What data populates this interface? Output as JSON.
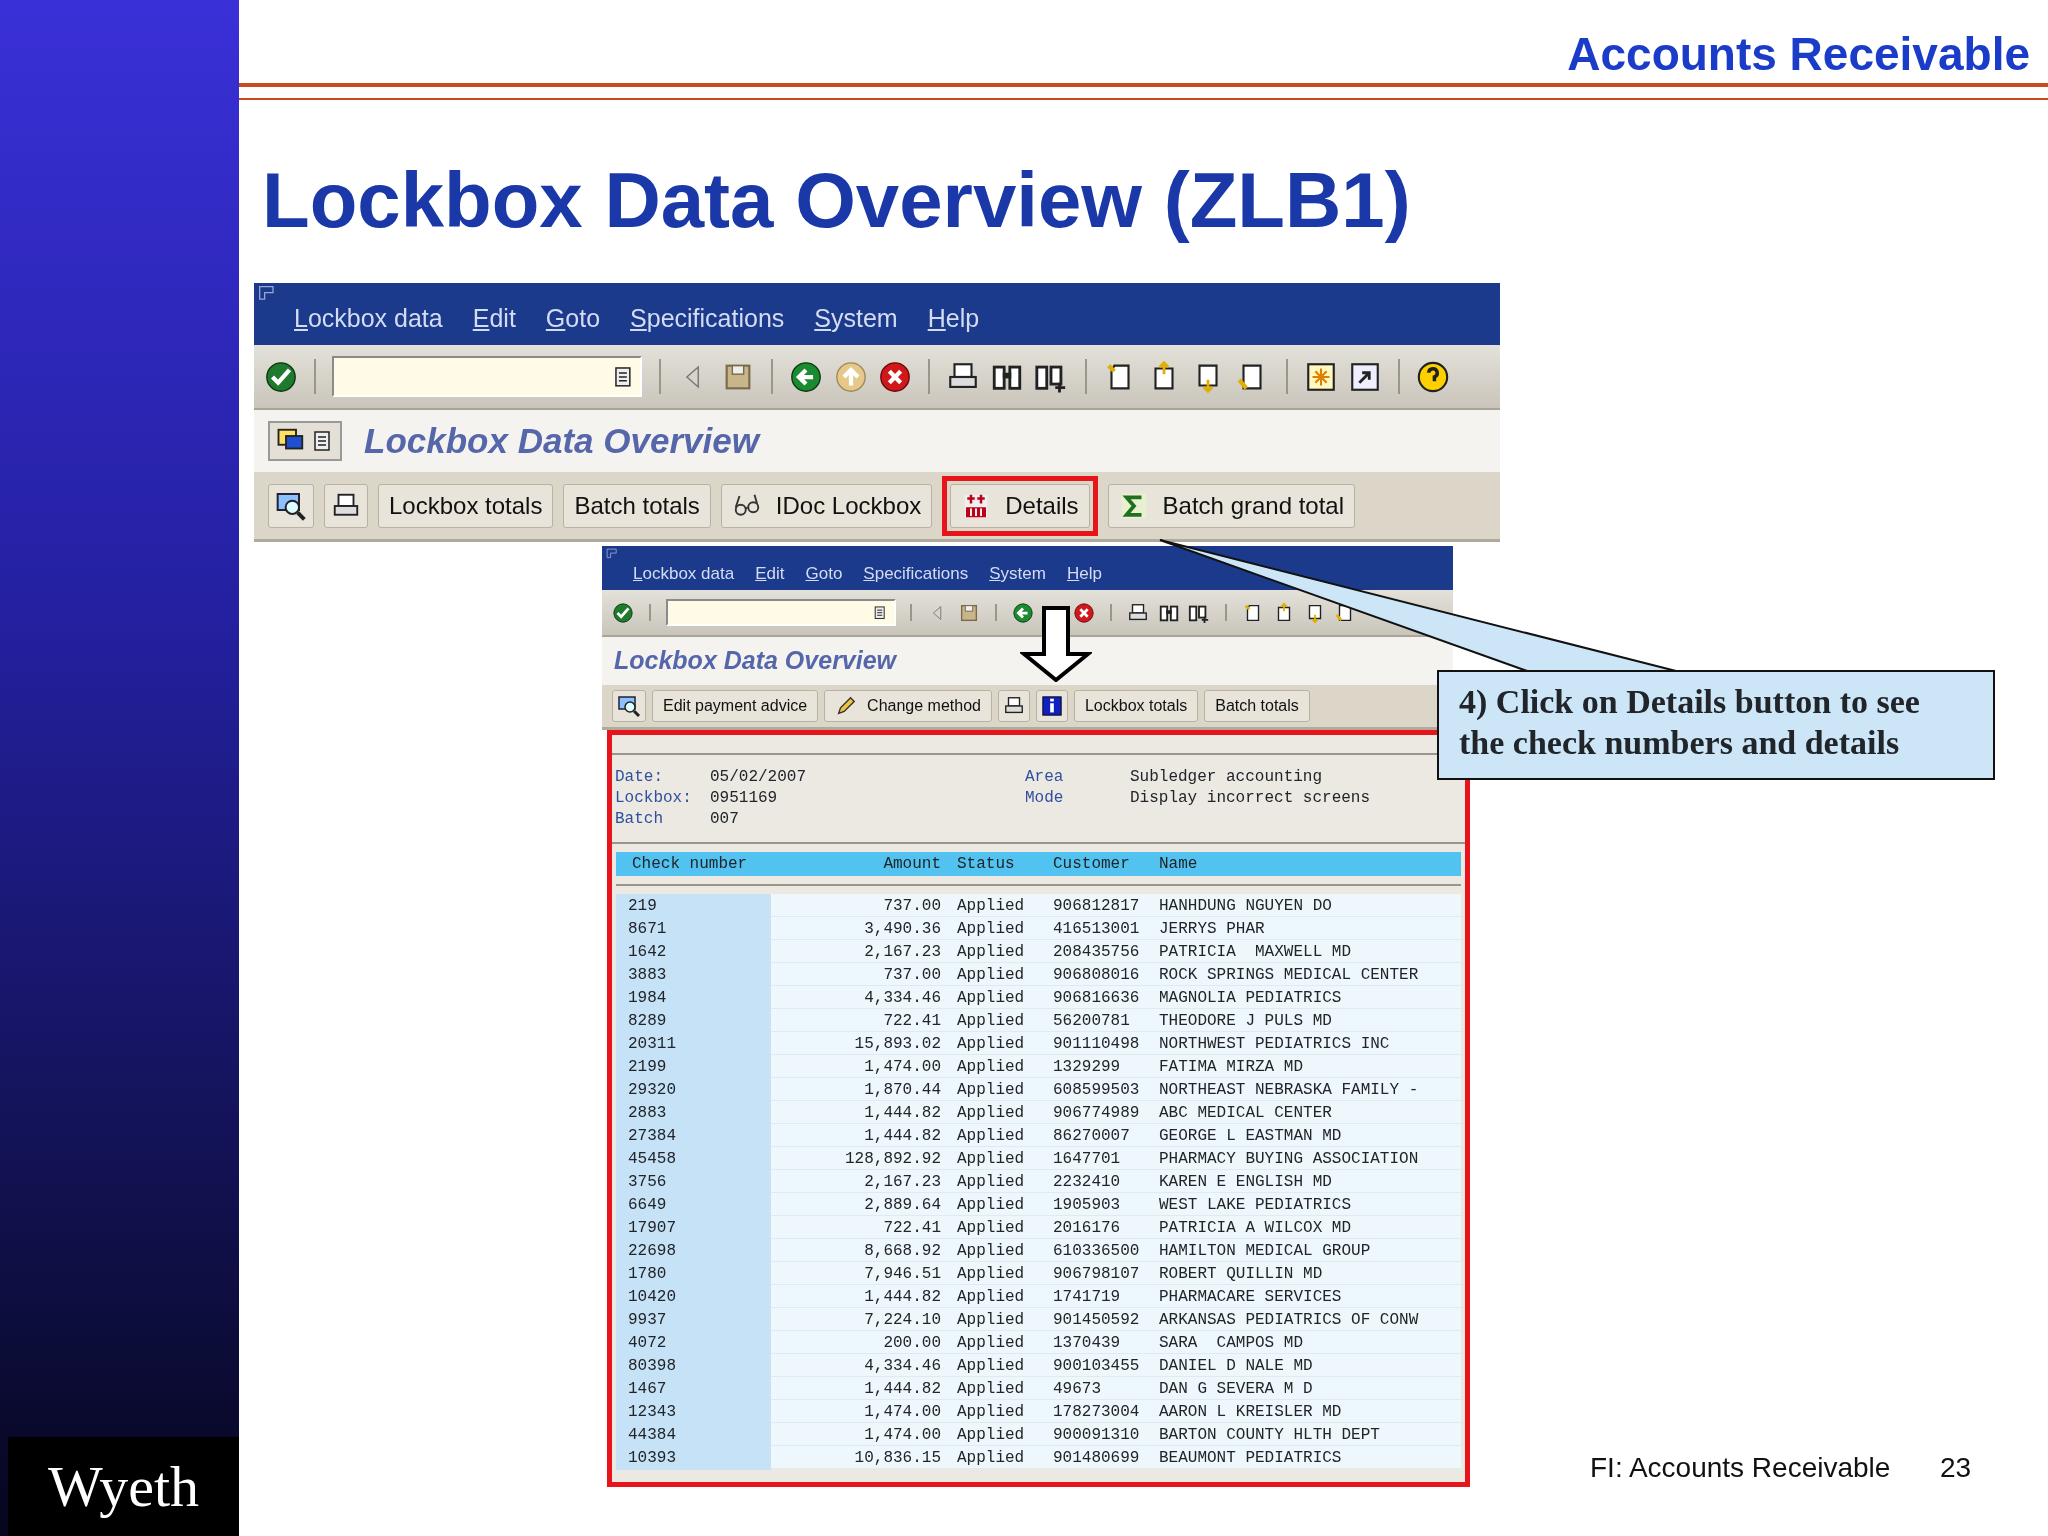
{
  "slide_header": "Accounts Receivable",
  "title": "Lockbox Data Overview (ZLB1)",
  "main_window": {
    "menu": [
      "Lockbox data",
      "Edit",
      "Goto",
      "Specifications",
      "System",
      "Help"
    ],
    "screen_title": "Lockbox Data Overview",
    "app_buttons": [
      {
        "label": "Lockbox totals",
        "highlighted": false
      },
      {
        "label": "Batch totals",
        "highlighted": false
      },
      {
        "label": "IDoc Lockbox",
        "highlighted": false
      },
      {
        "label": "Details",
        "highlighted": true
      },
      {
        "label": "Batch grand total",
        "highlighted": false
      }
    ]
  },
  "detail_window": {
    "menu": [
      "Lockbox data",
      "Edit",
      "Goto",
      "Specifications",
      "System",
      "Help"
    ],
    "screen_title": "Lockbox Data Overview",
    "app_buttons": [
      {
        "label": "Edit payment advice"
      },
      {
        "label": "Change method"
      },
      {
        "label": "Lockbox totals"
      },
      {
        "label": "Batch totals"
      }
    ],
    "fields_left": [
      {
        "label": "Date:",
        "value": "05/02/2007"
      },
      {
        "label": "Lockbox:",
        "value": "0951169"
      },
      {
        "label": "Batch",
        "value": "007"
      }
    ],
    "fields_right": [
      {
        "label": "Area",
        "value": "Subledger accounting"
      },
      {
        "label": "Mode",
        "value": "Display incorrect screens"
      }
    ],
    "columns": [
      "Check number",
      "Amount",
      "Status",
      "Customer",
      "Name"
    ],
    "rows": [
      [
        "219",
        "737.00",
        "Applied",
        "906812817",
        "HANHDUNG NGUYEN DO"
      ],
      [
        "8671",
        "3,490.36",
        "Applied",
        "416513001",
        "JERRYS PHAR"
      ],
      [
        "1642",
        "2,167.23",
        "Applied",
        "208435756",
        "PATRICIA  MAXWELL MD"
      ],
      [
        "3883",
        "737.00",
        "Applied",
        "906808016",
        "ROCK SPRINGS MEDICAL CENTER"
      ],
      [
        "1984",
        "4,334.46",
        "Applied",
        "906816636",
        "MAGNOLIA PEDIATRICS"
      ],
      [
        "8289",
        "722.41",
        "Applied",
        "56200781",
        "THEODORE J PULS MD"
      ],
      [
        "20311",
        "15,893.02",
        "Applied",
        "901110498",
        "NORTHWEST PEDIATRICS INC"
      ],
      [
        "2199",
        "1,474.00",
        "Applied",
        "1329299",
        "FATIMA MIRZA MD"
      ],
      [
        "29320",
        "1,870.44",
        "Applied",
        "608599503",
        "NORTHEAST NEBRASKA FAMILY -"
      ],
      [
        "2883",
        "1,444.82",
        "Applied",
        "906774989",
        "ABC MEDICAL CENTER"
      ],
      [
        "27384",
        "1,444.82",
        "Applied",
        "86270007",
        "GEORGE L EASTMAN MD"
      ],
      [
        "45458",
        "128,892.92",
        "Applied",
        "1647701",
        "PHARMACY BUYING ASSOCIATION"
      ],
      [
        "3756",
        "2,167.23",
        "Applied",
        "2232410",
        "KAREN E ENGLISH MD"
      ],
      [
        "6649",
        "2,889.64",
        "Applied",
        "1905903",
        "WEST LAKE PEDIATRICS"
      ],
      [
        "17907",
        "722.41",
        "Applied",
        "2016176",
        "PATRICIA A WILCOX MD"
      ],
      [
        "22698",
        "8,668.92",
        "Applied",
        "610336500",
        "HAMILTON MEDICAL GROUP"
      ],
      [
        "1780",
        "7,946.51",
        "Applied",
        "906798107",
        "ROBERT QUILLIN MD"
      ],
      [
        "10420",
        "1,444.82",
        "Applied",
        "1741719",
        "PHARMACARE SERVICES"
      ],
      [
        "9937",
        "7,224.10",
        "Applied",
        "901450592",
        "ARKANSAS PEDIATRICS OF CONW"
      ],
      [
        "4072",
        "200.00",
        "Applied",
        "1370439",
        "SARA  CAMPOS MD"
      ],
      [
        "80398",
        "4,334.46",
        "Applied",
        "900103455",
        "DANIEL D NALE MD"
      ],
      [
        "1467",
        "1,444.82",
        "Applied",
        "49673",
        "DAN G SEVERA M D"
      ],
      [
        "12343",
        "1,474.00",
        "Applied",
        "178273004",
        "AARON L KREISLER MD"
      ],
      [
        "44384",
        "1,474.00",
        "Applied",
        "900091310",
        "BARTON COUNTY HLTH DEPT"
      ],
      [
        "10393",
        "10,836.15",
        "Applied",
        "901480699",
        "BEAUMONT PEDIATRICS"
      ]
    ]
  },
  "callout": "4) Click on Details button to see the check numbers and details",
  "footer": {
    "text": "FI: Accounts Receivable",
    "page": "23"
  },
  "logo": "Wyeth"
}
